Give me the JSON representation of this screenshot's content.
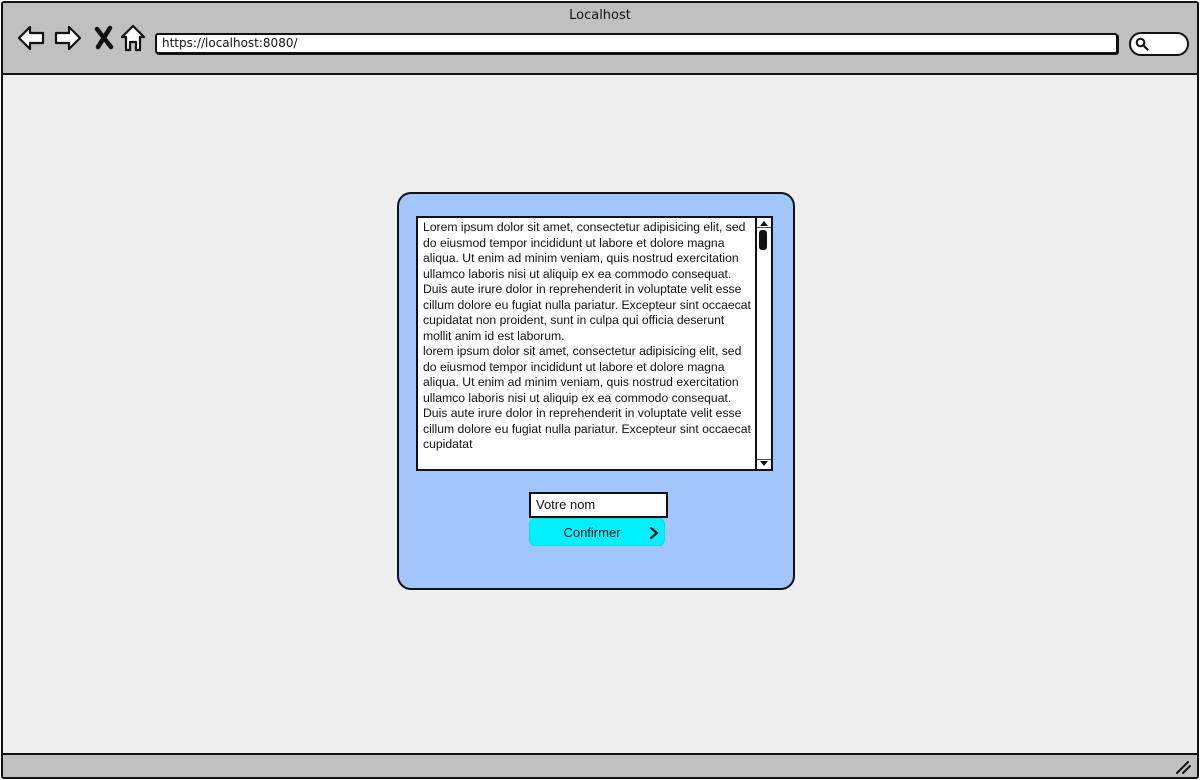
{
  "window": {
    "title": "Localhost"
  },
  "toolbar": {
    "icons": [
      "back-arrow-icon",
      "forward-arrow-icon",
      "stop-icon",
      "home-icon"
    ],
    "url": "https://localhost:8080/",
    "search_icon": "search-icon"
  },
  "panel": {
    "background_color": "#a1c6fa",
    "textarea_text": "Lorem ipsum dolor sit amet, consectetur adipisicing elit, sed do eiusmod tempor incididunt ut labore et dolore magna aliqua. Ut enim ad minim veniam, quis nostrud exercitation ullamco laboris nisi ut aliquip ex ea commodo consequat. Duis aute irure dolor in reprehenderit in voluptate velit esse cillum dolore eu fugiat nulla pariatur. Excepteur sint occaecat cupidatat non proident, sunt in culpa qui officia deserunt mollit anim id est laborum.\nlorem ipsum dolor sit amet, consectetur adipisicing elit, sed do eiusmod tempor incididunt ut labore et dolore magna aliqua. Ut enim ad minim veniam, quis nostrud exercitation ullamco laboris nisi ut aliquip ex ea commodo consequat. Duis aute irure dolor in reprehenderit in voluptate velit esse cillum dolore eu fugiat nulla pariatur. Excepteur sint occaecat cupidatat",
    "name_input_placeholder": "Votre nom",
    "confirm_label": "Confirmer",
    "confirm_color": "#00f0ff"
  }
}
